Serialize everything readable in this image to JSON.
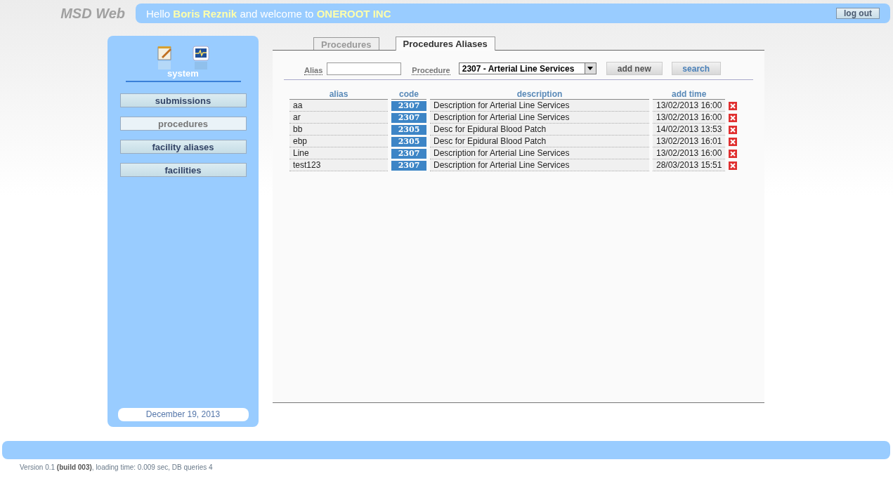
{
  "logo": "MSD Web",
  "greeting": "Hello **Boris Reznik** and welcome to **ONEROOT INC**",
  "logout": "log out",
  "sidebar": {
    "section": "system",
    "items": [
      {
        "label": "submissions",
        "selected": false
      },
      {
        "label": "procedures",
        "selected": true
      },
      {
        "label": "facility aliases",
        "selected": false
      },
      {
        "label": "facilities",
        "selected": false
      }
    ],
    "date": "December 19, 2013"
  },
  "tabs": [
    {
      "label": "Procedures",
      "selected": false
    },
    {
      "label": "Procedures Aliases",
      "selected": true
    }
  ],
  "filters": {
    "alias_label": "Alias",
    "procedure_label": "Procedure",
    "procedure_value": "2307 - Arterial Line Services",
    "add_button": "add new",
    "search_button": "search"
  },
  "table": {
    "columns": [
      "alias",
      "code",
      "description",
      "add time"
    ],
    "rows": [
      {
        "alias": "aa",
        "code": "2307",
        "description": "Description for Arterial Line Services",
        "time": "13/02/2013 16:00"
      },
      {
        "alias": "ar",
        "code": "2307",
        "description": "Description for Arterial Line Services",
        "time": "13/02/2013 16:00"
      },
      {
        "alias": "bb",
        "code": "2305",
        "description": "Desc for Epidural Blood Patch",
        "time": "14/02/2013 13:53"
      },
      {
        "alias": "ebp",
        "code": "2305",
        "description": "Desc for Epidural Blood Patch",
        "time": "13/02/2013 16:01"
      },
      {
        "alias": "Line",
        "code": "2307",
        "description": "Description for Arterial Line Services",
        "time": "13/02/2013 16:00"
      },
      {
        "alias": "test123",
        "code": "2307",
        "description": "Description for Arterial Line Services",
        "time": "28/03/2013 15:51"
      }
    ]
  },
  "footer": "Version 0.1 **(build 003)**, loading time: 0.009 sec, DB queries 4"
}
